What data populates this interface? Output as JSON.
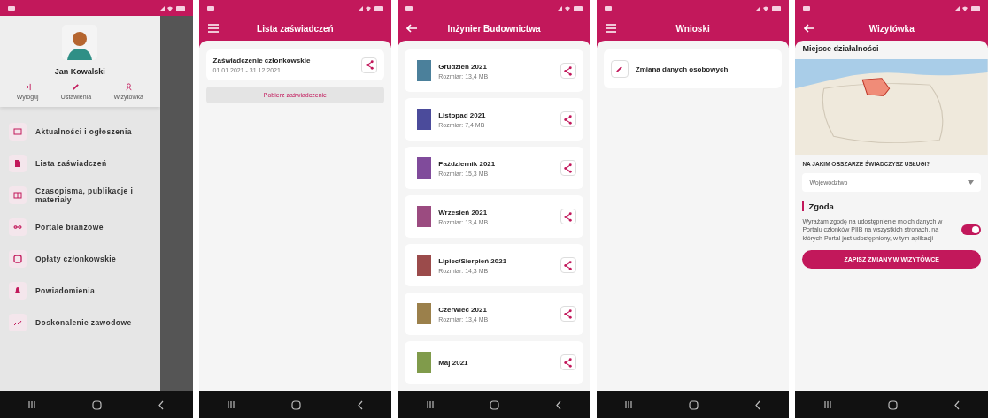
{
  "screens": [
    {
      "kind": "drawer",
      "user": {
        "name": "Jan Kowalski"
      },
      "actions": [
        {
          "kind": "logout",
          "label": "Wyloguj"
        },
        {
          "kind": "settings",
          "label": "Ustawienia"
        },
        {
          "kind": "card",
          "label": "Wizytówka"
        }
      ],
      "menu": [
        {
          "kind": "news",
          "label": "Aktualności i ogłoszenia"
        },
        {
          "kind": "doc",
          "label": "Lista zaświadczeń"
        },
        {
          "kind": "book",
          "label": "Czasopisma, publikacje i materiały"
        },
        {
          "kind": "link",
          "label": "Portale branżowe"
        },
        {
          "kind": "wallet",
          "label": "Opłaty członkowskie"
        },
        {
          "kind": "bell",
          "label": "Powiadomienia"
        },
        {
          "kind": "chart",
          "label": "Doskonalenie zawodowe"
        }
      ]
    },
    {
      "kind": "certificates",
      "header": {
        "kind": "menu",
        "title": "Lista zaświadczeń"
      },
      "items": [
        {
          "title": "Zaświadczenie członkowskie",
          "dates": "01.01.2021 - 31.12.2021"
        }
      ],
      "button": "Pobierz zaświadczenie"
    },
    {
      "kind": "magazines",
      "header": {
        "kind": "back",
        "title": "Inżynier Budownictwa"
      },
      "items": [
        {
          "title": "Grudzień 2021",
          "size": "Rozmiar: 13,4 MB"
        },
        {
          "title": "Listopad 2021",
          "size": "Rozmiar: 7,4 MB"
        },
        {
          "title": "Październik 2021",
          "size": "Rozmiar: 15,3 MB"
        },
        {
          "title": "Wrzesień 2021",
          "size": "Rozmiar: 13,4 MB"
        },
        {
          "title": "Lipiec/Sierpień 2021",
          "size": "Rozmiar: 14,3 MB"
        },
        {
          "title": "Czerwiec 2021",
          "size": "Rozmiar: 13,4 MB"
        },
        {
          "title": "Maj 2021"
        }
      ]
    },
    {
      "kind": "requests",
      "header": {
        "kind": "menu",
        "title": "Wnioski"
      },
      "items": [
        {
          "title": "Zmiana danych osobowych"
        }
      ]
    },
    {
      "kind": "business_card",
      "header": {
        "kind": "back",
        "title": "Wizytówka"
      },
      "section": "Miejsce działalności",
      "question": "NA JAKIM OBSZARZE ŚWIADCZYSZ USŁUGI?",
      "dropdown": "Województwo",
      "consent": {
        "heading": "Zgoda",
        "text": "Wyrażam zgodę na udostępnienie moich danych w Portalu członków PIIB na wszystkich stronach, na których Portal jest udostępniony, w tym aplikacji",
        "on": true
      },
      "button": "ZAPISZ ZMIANY W WIZYTÓWCE"
    }
  ]
}
